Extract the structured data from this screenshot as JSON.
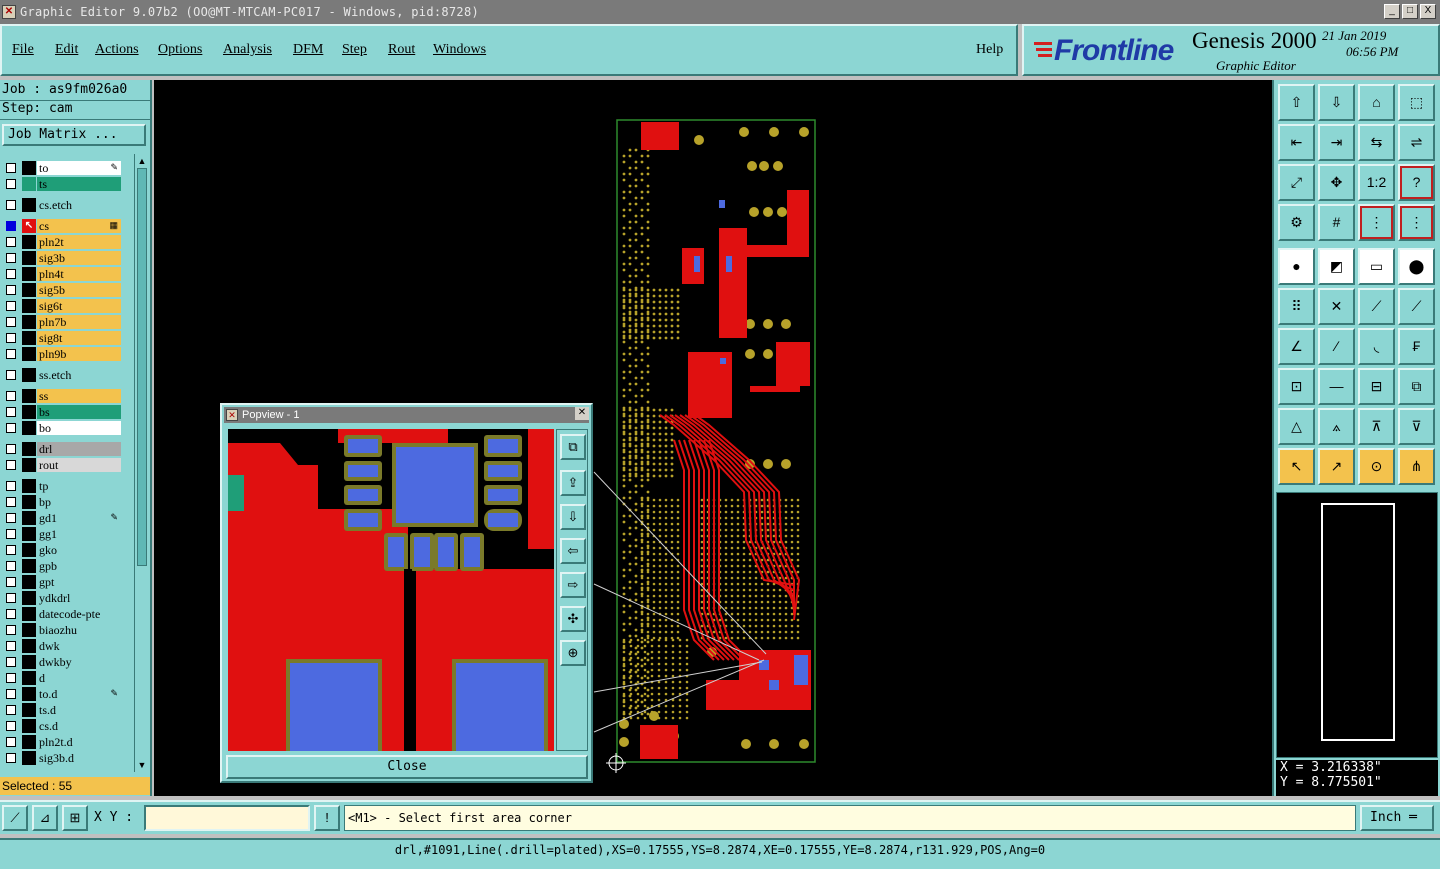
{
  "window": {
    "title": "Graphic Editor 9.07b2 (OO@MT-MTCAM-PC017 - Windows, pid:8728)",
    "controls": [
      "_",
      "□",
      "X"
    ]
  },
  "menu": {
    "items": [
      "File",
      "Edit",
      "Actions",
      "Options",
      "Analysis",
      "DFM",
      "Step",
      "Rout",
      "Windows"
    ],
    "help": "Help"
  },
  "brand": {
    "logo": "Frontline",
    "product": "Genesis 2000",
    "subtitle": "Graphic Editor",
    "date": "21 Jan 2019",
    "time": "06:56 PM"
  },
  "job": {
    "job_label": "Job : as9fm026a0",
    "step_label": "Step: cam",
    "matrix_button": "Job Matrix ..."
  },
  "layers": [
    {
      "name": "to",
      "color": "#ffffff",
      "flag": "✎"
    },
    {
      "name": "ts",
      "color": "#1f9e78",
      "flag": ""
    },
    {
      "name": "cs.etch",
      "color": "#8cd6d3",
      "flag": ""
    },
    {
      "name": "cs",
      "color": "#f3c24d",
      "flag": "▦",
      "active": true
    },
    {
      "name": "pln2t",
      "color": "#f3c24d",
      "flag": ""
    },
    {
      "name": "sig3b",
      "color": "#f3c24d",
      "flag": ""
    },
    {
      "name": "pln4t",
      "color": "#f3c24d",
      "flag": ""
    },
    {
      "name": "sig5b",
      "color": "#f3c24d",
      "flag": ""
    },
    {
      "name": "sig6t",
      "color": "#f3c24d",
      "flag": ""
    },
    {
      "name": "pln7b",
      "color": "#f3c24d",
      "flag": ""
    },
    {
      "name": "sig8t",
      "color": "#f3c24d",
      "flag": ""
    },
    {
      "name": "pln9b",
      "color": "#f3c24d",
      "flag": ""
    },
    {
      "name": "ss.etch",
      "color": "#8cd6d3",
      "flag": ""
    },
    {
      "name": "ss",
      "color": "#f3c24d",
      "flag": ""
    },
    {
      "name": "bs",
      "color": "#1f9e78",
      "flag": ""
    },
    {
      "name": "bo",
      "color": "#ffffff",
      "flag": ""
    },
    {
      "name": "drl",
      "color": "#a8a8a8",
      "flag": ""
    },
    {
      "name": "rout",
      "color": "#d8d8d8",
      "flag": ""
    },
    {
      "name": "tp",
      "color": "#8cd6d3",
      "flag": ""
    },
    {
      "name": "bp",
      "color": "#8cd6d3",
      "flag": ""
    },
    {
      "name": "gd1",
      "color": "#8cd6d3",
      "flag": "✎"
    },
    {
      "name": "gg1",
      "color": "#8cd6d3",
      "flag": ""
    },
    {
      "name": "gko",
      "color": "#8cd6d3",
      "flag": ""
    },
    {
      "name": "gpb",
      "color": "#8cd6d3",
      "flag": ""
    },
    {
      "name": "gpt",
      "color": "#8cd6d3",
      "flag": ""
    },
    {
      "name": "ydkdrl",
      "color": "#8cd6d3",
      "flag": ""
    },
    {
      "name": "datecode-pte",
      "color": "#8cd6d3",
      "flag": ""
    },
    {
      "name": "biaozhu",
      "color": "#8cd6d3",
      "flag": ""
    },
    {
      "name": "dwk",
      "color": "#8cd6d3",
      "flag": ""
    },
    {
      "name": "dwkby",
      "color": "#8cd6d3",
      "flag": ""
    },
    {
      "name": "d",
      "color": "#8cd6d3",
      "flag": ""
    },
    {
      "name": "to.d",
      "color": "#8cd6d3",
      "flag": "✎"
    },
    {
      "name": "ts.d",
      "color": "#8cd6d3",
      "flag": ""
    },
    {
      "name": "cs.d",
      "color": "#8cd6d3",
      "flag": ""
    },
    {
      "name": "pln2t.d",
      "color": "#8cd6d3",
      "flag": ""
    },
    {
      "name": "sig3b.d",
      "color": "#8cd6d3",
      "flag": ""
    }
  ],
  "selected": "Selected : 55",
  "popview": {
    "title": "Popview - 1",
    "close": "Close"
  },
  "coordinates": {
    "x": "X = 3.216338\"",
    "y": "Y = 8.775501\""
  },
  "bottom": {
    "xy_label": "X Y :",
    "xy_value": "",
    "prompt": "<M1> - Select first area corner",
    "units": "Inch"
  },
  "status": "drl,#1091,Line(.drill=plated),XS=0.17555,YS=8.2874,XE=0.17555,YE=8.2874,r131.929,POS,Ang=0",
  "colors": {
    "panel": "#8cd6d3",
    "copper": "#e01010",
    "pad": "#4d6ae0",
    "via": "#b7a22a",
    "board_outline": "#2e8b2e"
  }
}
